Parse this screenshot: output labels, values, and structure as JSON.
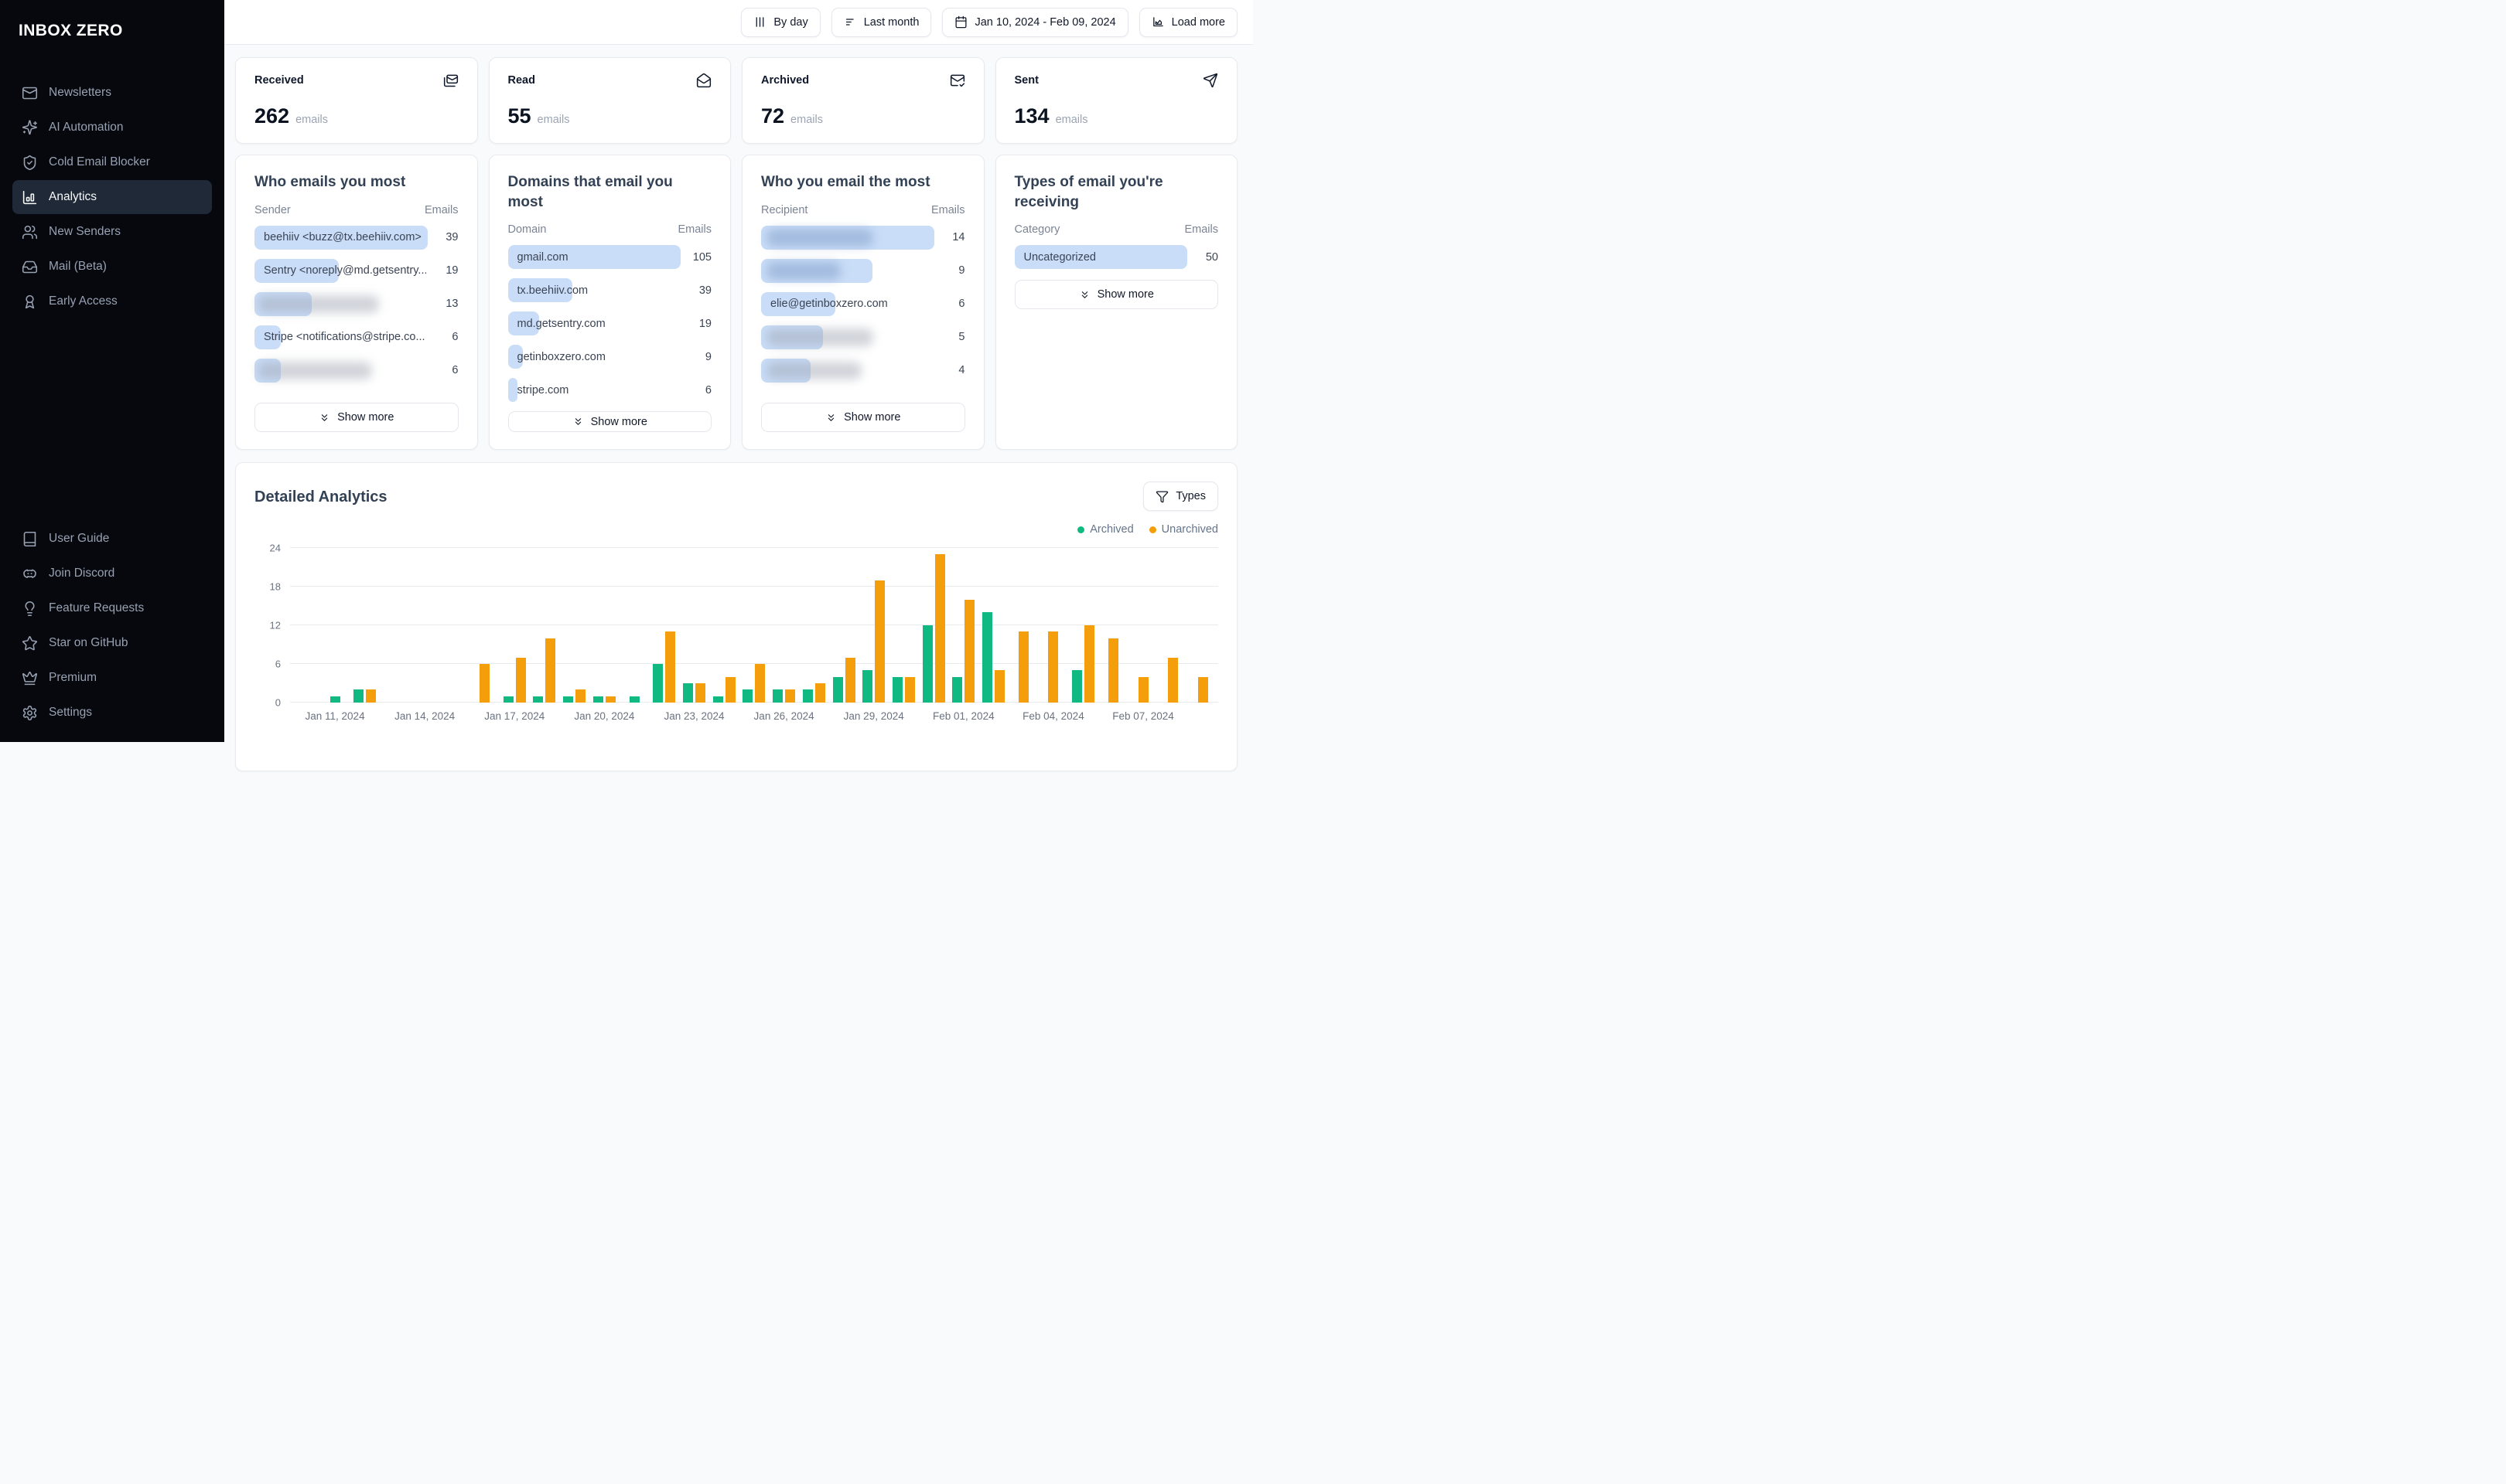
{
  "app": {
    "name": "INBOX ZERO"
  },
  "colors": {
    "archived": "#10b981",
    "unarchived": "#f59e0b",
    "list_bar": "#c9ddf8",
    "sidebar_bg": "#06080d",
    "active_item_bg": "#1f2937"
  },
  "sidebar": {
    "top_items": [
      {
        "label": "Newsletters",
        "icon": "mail-icon",
        "active": false
      },
      {
        "label": "AI Automation",
        "icon": "sparkles-icon",
        "active": false
      },
      {
        "label": "Cold Email Blocker",
        "icon": "shield-check-icon",
        "active": false
      },
      {
        "label": "Analytics",
        "icon": "bar-chart-icon",
        "active": true
      },
      {
        "label": "New Senders",
        "icon": "users-icon",
        "active": false
      },
      {
        "label": "Mail (Beta)",
        "icon": "inbox-icon",
        "active": false
      },
      {
        "label": "Early Access",
        "icon": "award-icon",
        "active": false
      }
    ],
    "bottom_items": [
      {
        "label": "User Guide",
        "icon": "book-icon",
        "active": false
      },
      {
        "label": "Join Discord",
        "icon": "discord-icon",
        "active": false
      },
      {
        "label": "Feature Requests",
        "icon": "lightbulb-icon",
        "active": false
      },
      {
        "label": "Star on GitHub",
        "icon": "star-icon",
        "active": false
      },
      {
        "label": "Premium",
        "icon": "crown-icon",
        "active": false
      },
      {
        "label": "Settings",
        "icon": "gear-icon",
        "active": false
      }
    ]
  },
  "topbar": {
    "buttons": [
      {
        "label": "By day",
        "icon": "columns-icon",
        "name": "by-day-button"
      },
      {
        "label": "Last month",
        "icon": "filter-lines-icon",
        "name": "last-month-button"
      },
      {
        "label": "Jan 10, 2024 - Feb 09, 2024",
        "icon": "calendar-icon",
        "name": "date-range-button"
      },
      {
        "label": "Load more",
        "icon": "chart-line-icon",
        "name": "load-more-button"
      }
    ]
  },
  "stats": [
    {
      "label": "Received",
      "value": "262",
      "unit": "emails",
      "icon": "mails-icon"
    },
    {
      "label": "Read",
      "value": "55",
      "unit": "emails",
      "icon": "mail-open-icon"
    },
    {
      "label": "Archived",
      "value": "72",
      "unit": "emails",
      "icon": "mail-check-icon"
    },
    {
      "label": "Sent",
      "value": "134",
      "unit": "emails",
      "icon": "send-icon"
    }
  ],
  "list_cards": [
    {
      "title": "Who emails you most",
      "col_label": "Sender",
      "col_value": "Emails",
      "max": 39,
      "button_position": "bottom",
      "rows": [
        {
          "label": "beehiiv <buzz@tx.beehiiv.com>",
          "value": 39,
          "smudge": null
        },
        {
          "label": "Sentry <noreply@md.getsentry....",
          "value": 19,
          "smudge": null
        },
        {
          "label": "",
          "value": 13,
          "smudge": {
            "left": 2,
            "width": 70,
            "tint": "gray"
          }
        },
        {
          "label": "Stripe <notifications@stripe.co...",
          "value": 6,
          "smudge": null
        },
        {
          "label": "",
          "value": 6,
          "smudge": {
            "left": 2,
            "width": 66,
            "tint": "gray"
          }
        }
      ],
      "show_more_label": "Show more"
    },
    {
      "title": "Domains that email you most",
      "col_label": "Domain",
      "col_value": "Emails",
      "max": 105,
      "button_position": "bottom",
      "rows": [
        {
          "label": "gmail.com",
          "value": 105,
          "smudge": null
        },
        {
          "label": "tx.beehiiv.com",
          "value": 39,
          "smudge": null
        },
        {
          "label": "md.getsentry.com",
          "value": 19,
          "smudge": null
        },
        {
          "label": "getinboxzero.com",
          "value": 9,
          "smudge": null
        },
        {
          "label": "stripe.com",
          "value": 6,
          "smudge": null
        }
      ],
      "show_more_label": "Show more"
    },
    {
      "title": "Who you email the most",
      "col_label": "Recipient",
      "col_value": "Emails",
      "max": 14,
      "button_position": "bottom",
      "rows": [
        {
          "label": "",
          "value": 14,
          "smudge": {
            "left": 3,
            "width": 62,
            "tint": "blue"
          }
        },
        {
          "label": "",
          "value": 9,
          "smudge": {
            "left": 3,
            "width": 43,
            "tint": "blue"
          }
        },
        {
          "label": "elie@getinboxzero.com",
          "value": 6,
          "smudge": null
        },
        {
          "label": "",
          "value": 5,
          "smudge": {
            "left": 3,
            "width": 62,
            "tint": "gray"
          }
        },
        {
          "label": "",
          "value": 4,
          "smudge": {
            "left": 3,
            "width": 55,
            "tint": "gray"
          }
        }
      ],
      "show_more_label": "Show more"
    },
    {
      "title": "Types of email you're receiving",
      "col_label": "Category",
      "col_value": "Emails",
      "max": 50,
      "button_position": "inline",
      "rows": [
        {
          "label": "Uncategorized",
          "value": 50,
          "smudge": null
        }
      ],
      "show_more_label": "Show more"
    }
  ],
  "detailed": {
    "title": "Detailed Analytics",
    "filter_button_label": "Types",
    "legend": [
      {
        "label": "Archived",
        "color": "#10b981"
      },
      {
        "label": "Unarchived",
        "color": "#f59e0b"
      }
    ]
  },
  "chart_data": {
    "type": "bar",
    "title": "Detailed Analytics",
    "xlabel": "",
    "ylabel": "",
    "ylim": [
      0,
      24
    ],
    "yticks": [
      0,
      6,
      12,
      18,
      24
    ],
    "grid": true,
    "legend_position": "top-right",
    "categories": [
      "Jan 10, 2024",
      "Jan 11, 2024",
      "Jan 12, 2024",
      "Jan 13, 2024",
      "Jan 14, 2024",
      "Jan 15, 2024",
      "Jan 16, 2024",
      "Jan 17, 2024",
      "Jan 18, 2024",
      "Jan 19, 2024",
      "Jan 20, 2024",
      "Jan 21, 2024",
      "Jan 22, 2024",
      "Jan 23, 2024",
      "Jan 24, 2024",
      "Jan 25, 2024",
      "Jan 26, 2024",
      "Jan 27, 2024",
      "Jan 28, 2024",
      "Jan 29, 2024",
      "Jan 30, 2024",
      "Jan 31, 2024",
      "Feb 01, 2024",
      "Feb 02, 2024",
      "Feb 03, 2024",
      "Feb 04, 2024",
      "Feb 05, 2024",
      "Feb 06, 2024",
      "Feb 07, 2024",
      "Feb 08, 2024",
      "Feb 09, 2024"
    ],
    "tick_indices": [
      1,
      4,
      7,
      10,
      13,
      16,
      19,
      22,
      25,
      28
    ],
    "series": [
      {
        "name": "Archived",
        "color": "#10b981",
        "values": [
          0,
          1,
          2,
          0,
          0,
          0,
          0,
          1,
          1,
          1,
          1,
          1,
          6,
          3,
          1,
          2,
          2,
          2,
          4,
          5,
          4,
          12,
          4,
          14,
          0,
          0,
          5,
          0,
          0,
          0,
          0
        ]
      },
      {
        "name": "Unarchived",
        "color": "#f59e0b",
        "values": [
          0,
          0,
          2,
          0,
          0,
          0,
          6,
          7,
          10,
          2,
          1,
          0,
          11,
          3,
          4,
          6,
          2,
          3,
          7,
          19,
          4,
          23,
          16,
          5,
          11,
          11,
          12,
          10,
          4,
          7,
          4
        ]
      }
    ]
  }
}
